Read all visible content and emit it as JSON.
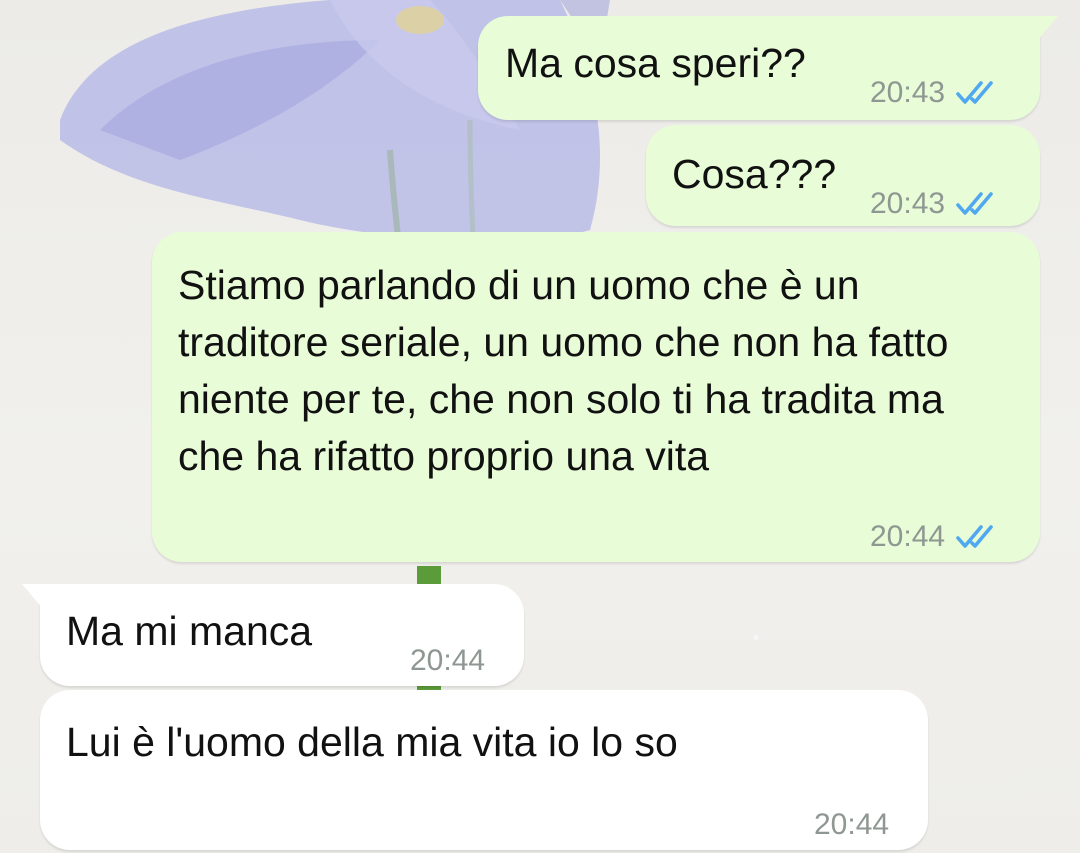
{
  "colors": {
    "outgoing_bubble": "#e8fcd8",
    "incoming_bubble": "#ffffff",
    "timestamp": "#8e9791",
    "read_ticks": "#4fa8f0"
  },
  "messages": [
    {
      "direction": "outgoing",
      "text": "Ma cosa speri??",
      "time": "20:43",
      "status_icon": "double-check-read-icon"
    },
    {
      "direction": "outgoing",
      "text": "Cosa???",
      "time": "20:43",
      "status_icon": "double-check-read-icon"
    },
    {
      "direction": "outgoing",
      "text": "Stiamo parlando di un uomo che è un traditore seriale, un uomo che non ha fatto niente per te, che non solo ti ha tradita ma che ha rifatto proprio una vita",
      "time": "20:44",
      "status_icon": "double-check-read-icon"
    },
    {
      "direction": "incoming",
      "text": "Ma mi manca",
      "time": "20:44"
    },
    {
      "direction": "incoming",
      "text": "Lui è l'uomo della mia vita io lo so",
      "time": "20:44"
    }
  ]
}
